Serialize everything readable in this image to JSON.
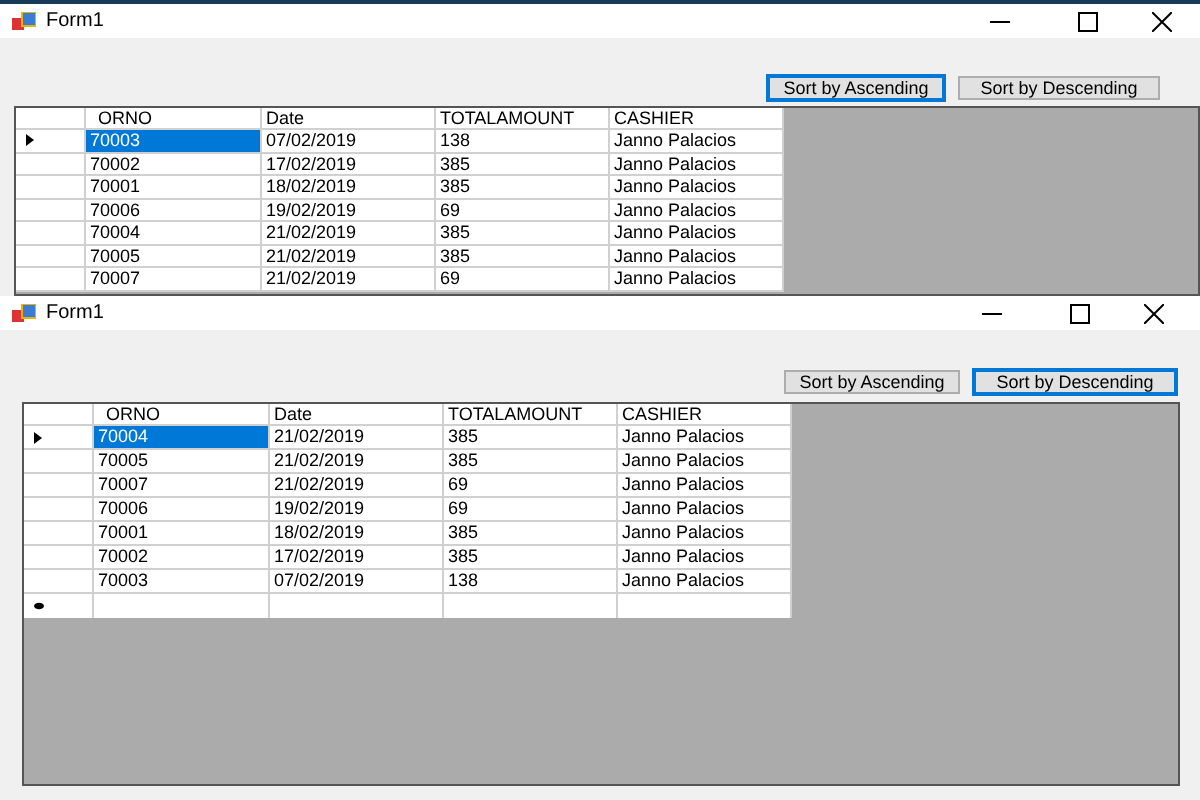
{
  "windows": [
    {
      "title": "Form1",
      "buttons": [
        {
          "label": "Sort by Ascending",
          "focused": true
        },
        {
          "label": "Sort by Descending",
          "focused": false
        }
      ],
      "columns": [
        "ORNO",
        "Date",
        "TOTALAMOUNT",
        "CASHIER"
      ],
      "rows": [
        {
          "cells": [
            "70003",
            "07/02/2019",
            "138",
            "Janno Palacios"
          ],
          "selected": true
        },
        {
          "cells": [
            "70002",
            "17/02/2019",
            "385",
            "Janno Palacios"
          ],
          "selected": false
        },
        {
          "cells": [
            "70001",
            "18/02/2019",
            "385",
            "Janno Palacios"
          ],
          "selected": false
        },
        {
          "cells": [
            "70006",
            "19/02/2019",
            "69",
            "Janno Palacios"
          ],
          "selected": false
        },
        {
          "cells": [
            "70004",
            "21/02/2019",
            "385",
            "Janno Palacios"
          ],
          "selected": false
        },
        {
          "cells": [
            "70005",
            "21/02/2019",
            "385",
            "Janno Palacios"
          ],
          "selected": false
        },
        {
          "cells": [
            "70007",
            "21/02/2019",
            "69",
            "Janno Palacios"
          ],
          "selected": false
        }
      ]
    },
    {
      "title": "Form1",
      "buttons": [
        {
          "label": "Sort by Ascending",
          "focused": false
        },
        {
          "label": "Sort by Descending",
          "focused": true
        }
      ],
      "columns": [
        "ORNO",
        "Date",
        "TOTALAMOUNT",
        "CASHIER"
      ],
      "rows": [
        {
          "cells": [
            "70004",
            "21/02/2019",
            "385",
            "Janno Palacios"
          ],
          "selected": true
        },
        {
          "cells": [
            "70005",
            "21/02/2019",
            "385",
            "Janno Palacios"
          ],
          "selected": false
        },
        {
          "cells": [
            "70007",
            "21/02/2019",
            "69",
            "Janno Palacios"
          ],
          "selected": false
        },
        {
          "cells": [
            "70006",
            "19/02/2019",
            "69",
            "Janno Palacios"
          ],
          "selected": false
        },
        {
          "cells": [
            "70001",
            "18/02/2019",
            "385",
            "Janno Palacios"
          ],
          "selected": false
        },
        {
          "cells": [
            "70002",
            "17/02/2019",
            "385",
            "Janno Palacios"
          ],
          "selected": false
        },
        {
          "cells": [
            "70003",
            "07/02/2019",
            "138",
            "Janno Palacios"
          ],
          "selected": false
        }
      ],
      "new_row": true
    }
  ]
}
